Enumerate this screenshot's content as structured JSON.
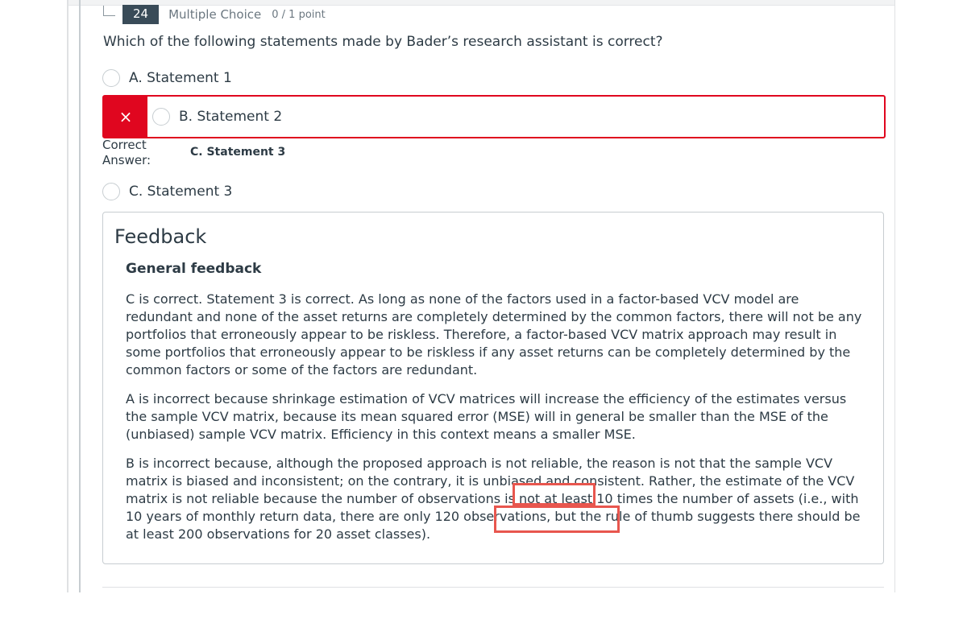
{
  "question": {
    "number": "24",
    "type": "Multiple Choice",
    "points": "0 / 1 point",
    "text": "Which of the following statements made by Bader’s research assistant is correct?"
  },
  "answers": [
    {
      "label": "A. Statement 1",
      "selected": false
    },
    {
      "label": "B. Statement 2",
      "selected": true,
      "incorrect": true
    },
    {
      "label": "C. Statement 3",
      "selected": false
    }
  ],
  "wrong_mark": "×",
  "correct_answer": {
    "label": "Correct Answer:",
    "value": "C. Statement 3"
  },
  "feedback": {
    "title": "Feedback",
    "subtitle": "General feedback",
    "paragraphs": [
      "C is correct. Statement 3 is correct. As long as none of the factors used in a factor-based VCV model are redundant and none of the asset returns are completely determined by the common factors, there will not be any portfolios that erroneously appear to be riskless. Therefore, a factor-based VCV matrix approach may result in some portfolios that erroneously appear to be riskless if any asset returns can be completely determined by the common factors or some of the factors are redundant.",
      "A is incorrect because shrinkage estimation of VCV matrices will increase the efficiency of the estimates versus the sample VCV matrix, because its mean squared error (MSE) will in general be smaller than the MSE of the (unbiased) sample VCV matrix. Efficiency in this context means a smaller MSE.",
      "B is incorrect because, although the proposed approach is not reliable, the reason is not that the sample VCV matrix is biased and inconsistent; on the contrary, it is unbiased and consistent. Rather, the estimate of the VCV matrix is not reliable because the number of observations is not at least 10 times the number of assets (i.e., with 10 years of monthly return data, there are only 120 observations, but the rule of thumb suggests there should be at least 200 observations for 20 asset classes)."
    ]
  },
  "colors": {
    "incorrect": "#e0061f",
    "highlight": "#e8564e",
    "text": "#2d3b45",
    "badge": "#394b58"
  }
}
